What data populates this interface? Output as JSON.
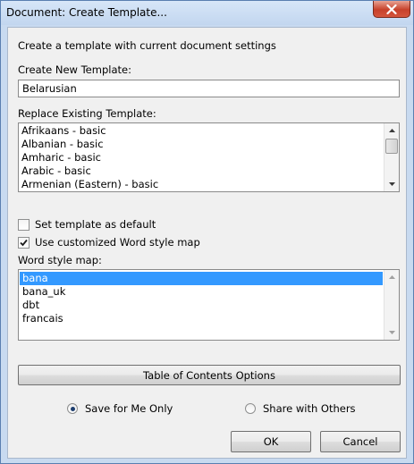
{
  "window": {
    "title": "Document: Create Template...",
    "close_icon": "close-icon",
    "close_color": "#c7412a"
  },
  "description": "Create a template with current document settings",
  "create_new": {
    "label": "Create New Template:",
    "value": "Belarusian"
  },
  "replace_existing": {
    "label": "Replace Existing Template:",
    "items": [
      "Afrikaans - basic",
      "Albanian - basic",
      "Amharic - basic",
      "Arabic - basic",
      "Armenian (Eastern) - basic"
    ]
  },
  "options": {
    "set_default": {
      "label": "Set template as default",
      "checked": false
    },
    "use_style_map": {
      "label": "Use customized Word style map",
      "checked": true
    }
  },
  "word_style_map": {
    "label": "Word style map:",
    "items": [
      "bana",
      "bana_uk",
      "dbt",
      "francais"
    ],
    "selected": "bana",
    "selection_color": "#3399ff"
  },
  "toc_button": "Table of Contents Options",
  "sharing": {
    "save_for_me": {
      "label": "Save for Me Only",
      "selected": true
    },
    "share_with_others": {
      "label": "Share with Others",
      "selected": false
    }
  },
  "buttons": {
    "ok": "OK",
    "cancel": "Cancel"
  }
}
